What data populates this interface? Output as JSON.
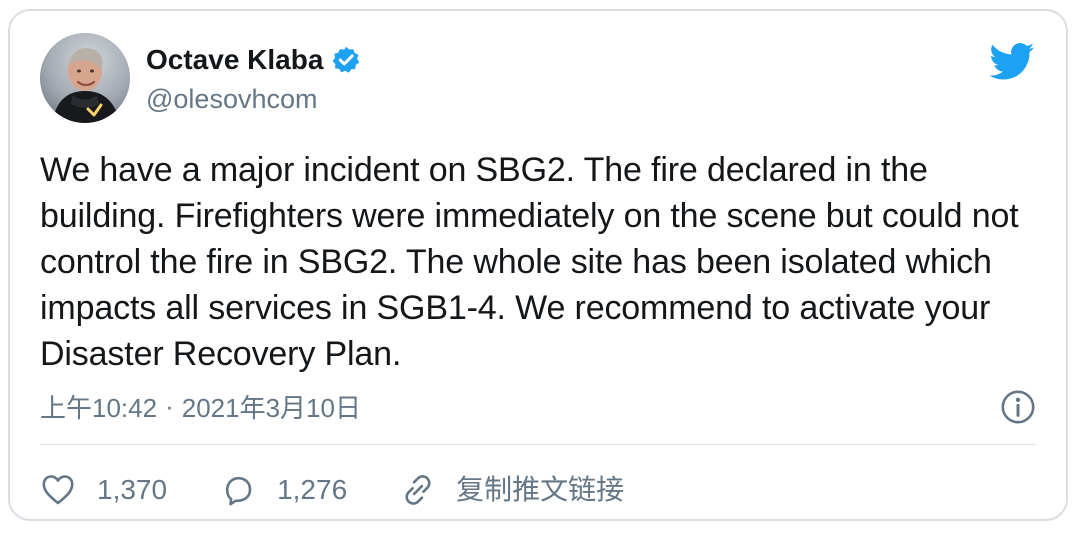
{
  "author": {
    "name": "Octave Klaba",
    "handle": "@olesovhcom",
    "verified": true
  },
  "tweet": {
    "text": "We have a major incident on SBG2. The fire declared in the building. Firefighters were immediately on the scene but could not control the fire in SBG2. The whole site has been isolated which impacts all services in SGB1-4. We recommend to activate your Disaster Recovery Plan.",
    "time": "上午10:42",
    "separator": "·",
    "date": "2021年3月10日"
  },
  "actions": {
    "likes": "1,370",
    "replies": "1,276",
    "copy_link": "复制推文链接"
  },
  "icons": {
    "brand": "twitter-bird-icon",
    "verified": "verified-badge-icon",
    "info": "info-icon",
    "like": "heart-icon",
    "reply": "reply-bubble-icon",
    "link": "link-icon"
  },
  "colors": {
    "text": "#14171a",
    "secondary_text": "#657786",
    "twitter_blue": "#1da1f2",
    "border": "#d8dde2"
  }
}
